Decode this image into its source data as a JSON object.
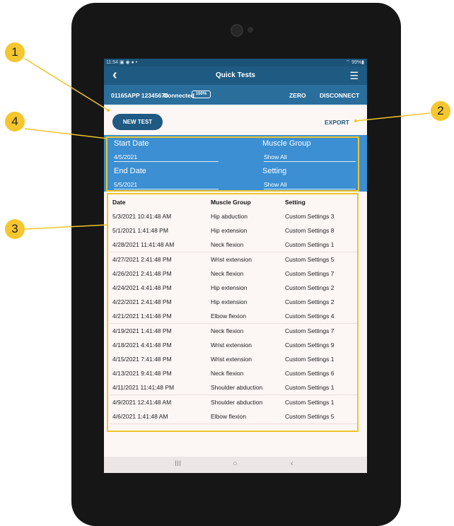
{
  "status_bar": {
    "time_icons": "11:54 ▣ ◉ ● •",
    "battery": "⌔ 99%▮"
  },
  "header": {
    "back_icon": "chevron-left-icon",
    "title": "Quick Tests",
    "menu_icon": "hamburger-menu-icon"
  },
  "device": {
    "id": "01165APP 12345678",
    "status": "Connected",
    "battery": "100%",
    "zero_label": "ZERO",
    "disconnect_label": "DISCONNECT"
  },
  "actions": {
    "new_test_label": "NEW TEST",
    "export_label": "EXPORT"
  },
  "filters": {
    "start_date_label": "Start Date",
    "start_date_value": "4/5/2021",
    "end_date_label": "End Date",
    "end_date_value": "5/5/2021",
    "muscle_group_label": "Muscle Group",
    "muscle_group_value": "Show All",
    "setting_label": "Setting",
    "setting_value": "Show All"
  },
  "table": {
    "columns": [
      "Date",
      "Muscle Group",
      "Setting"
    ],
    "rows": [
      [
        "5/3/2021 10:41:48 AM",
        "Hip abduction",
        "Custom Settings 3"
      ],
      [
        "5/1/2021 1:41:48 PM",
        "Hip extension",
        "Custom Settings 8"
      ],
      [
        "4/28/2021 11:41:48 AM",
        "Neck flexion",
        "Custom Settings 1"
      ],
      [
        "4/27/2021 2:41:48 PM",
        "Wrist extension",
        "Custom Settings 5"
      ],
      [
        "4/26/2021 2:41:48 PM",
        "Neck flexion",
        "Custom Settings 7"
      ],
      [
        "4/24/2021 4:41:48 PM",
        "Hip extension",
        "Custom Settings 2"
      ],
      [
        "4/22/2021 2:41:48 PM",
        "Hip extension",
        "Custom Settings 2"
      ],
      [
        "4/21/2021 1:41:48 PM",
        "Elbow flexion",
        "Custom Settings 4"
      ],
      [
        "4/19/2021 1:41:48 PM",
        "Neck flexion",
        "Custom Settings 7"
      ],
      [
        "4/18/2021 4:41:48 PM",
        "Wrist extension",
        "Custom Settings 9"
      ],
      [
        "4/15/2021 7:41:48 PM",
        "Wrist extension",
        "Custom Settings 1"
      ],
      [
        "4/13/2021 9:41:48 PM",
        "Neck flexion",
        "Custom Settings 6"
      ],
      [
        "4/11/2021 11:41:48 PM",
        "Shoulder abduction",
        "Custom Settings 1"
      ],
      [
        "4/9/2021 12:41:48 AM",
        "Shoulder abduction",
        "Custom Settings 1"
      ],
      [
        "4/6/2021 1:41:48 AM",
        "Elbow flexion",
        "Custom Settings 5"
      ]
    ]
  },
  "nav_bar": {
    "recents": "III",
    "home": "○",
    "back": "‹"
  },
  "annotations": [
    "1",
    "2",
    "3",
    "4"
  ],
  "colors": {
    "header": "#1e5a82",
    "device_bar": "#2a6e9c",
    "filters": "#3b8fd2",
    "annotation": "#f5c62d"
  }
}
